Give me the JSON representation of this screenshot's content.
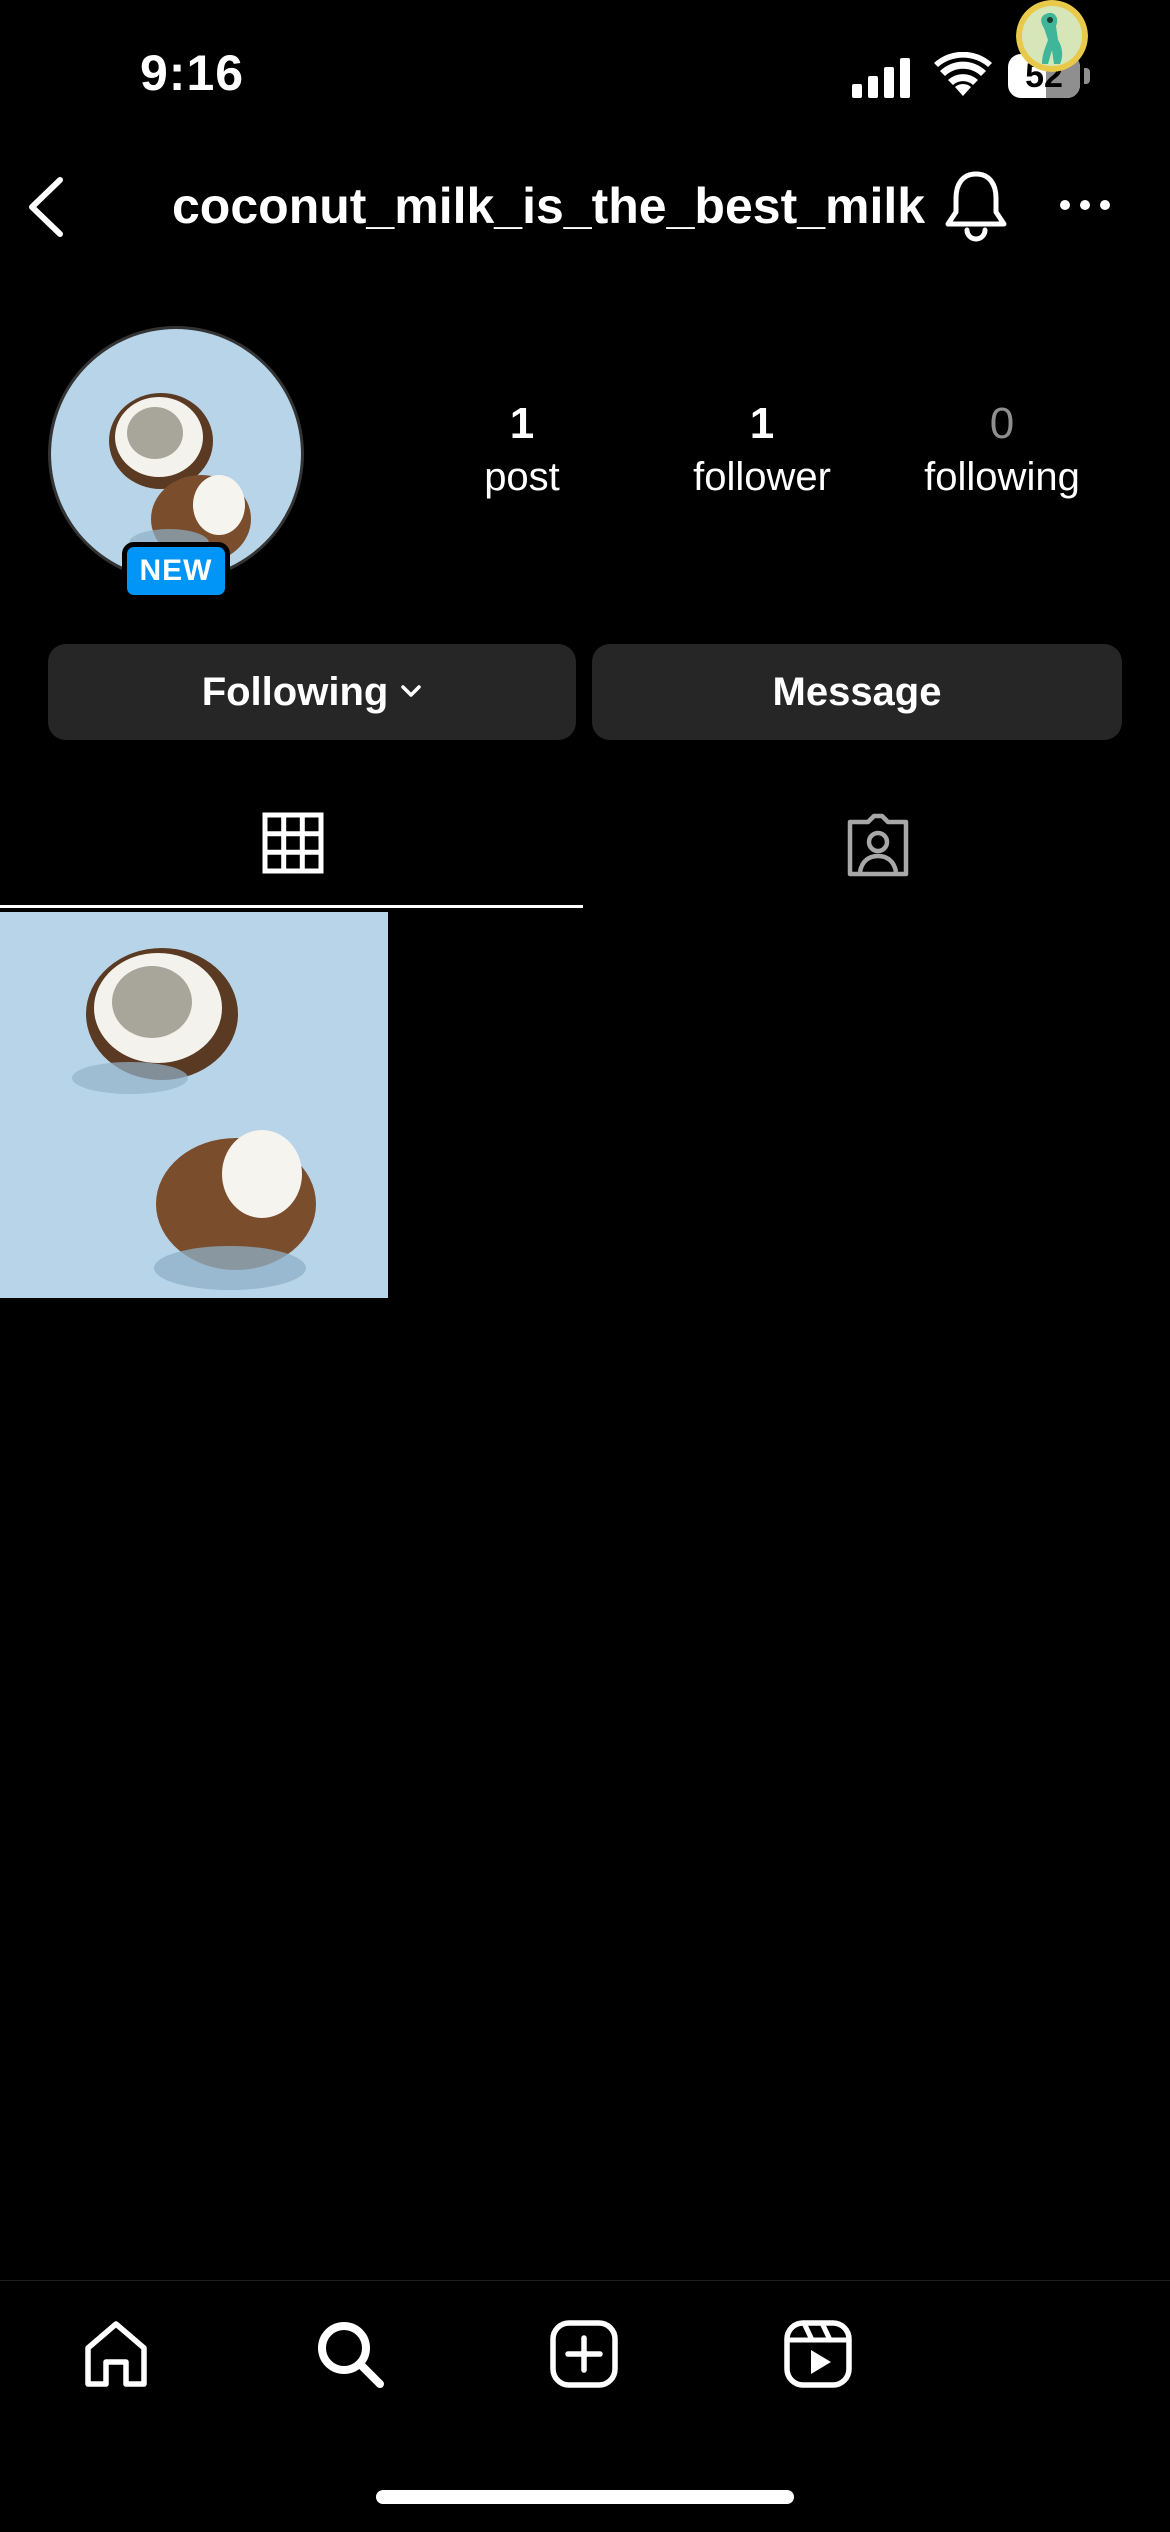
{
  "status_bar": {
    "time": "9:16",
    "battery": "52"
  },
  "header": {
    "username": "coconut_milk_is_the_best_milk"
  },
  "profile": {
    "badge": "NEW",
    "stats": [
      {
        "value": "1",
        "label": "post"
      },
      {
        "value": "1",
        "label": "follower"
      },
      {
        "value": "0",
        "label": "following"
      }
    ]
  },
  "actions": {
    "following_label": "Following",
    "message_label": "Message"
  },
  "tabs": [
    {
      "icon": "grid-icon",
      "selected": true
    },
    {
      "icon": "tagged-icon",
      "selected": false
    }
  ],
  "colors": {
    "background": "#000000",
    "button": "#262626",
    "badge": "#0095f6",
    "muted": "#8e8e8e"
  },
  "nav": [
    "home-icon",
    "search-icon",
    "create-icon",
    "reels-icon",
    "profile-avatar"
  ]
}
